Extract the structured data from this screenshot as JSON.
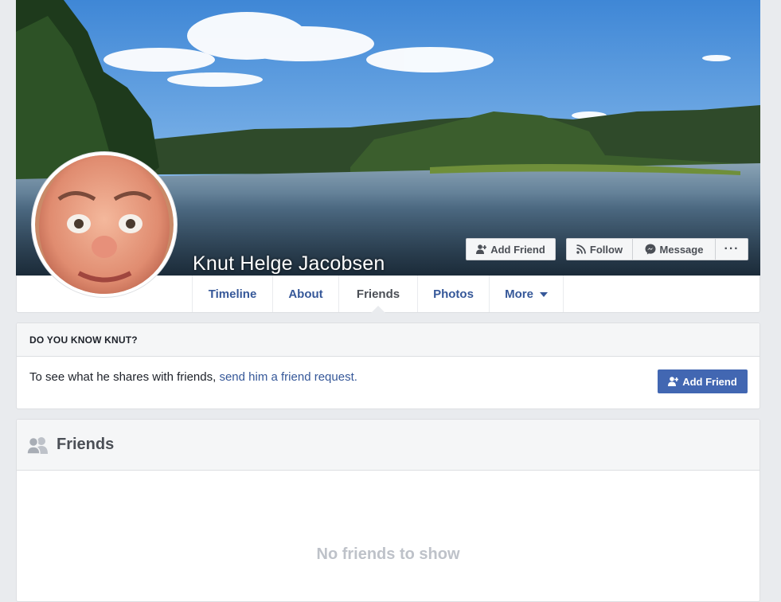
{
  "profile": {
    "name": "Knut Helge Jacobsen"
  },
  "actions": {
    "add_friend": "Add Friend",
    "follow": "Follow",
    "message": "Message",
    "more_dots": "···"
  },
  "tabs": [
    {
      "label": "Timeline"
    },
    {
      "label": "About"
    },
    {
      "label": "Friends"
    },
    {
      "label": "Photos"
    },
    {
      "label": "More"
    }
  ],
  "know_card": {
    "heading": "DO YOU KNOW KNUT?",
    "text": "To see what he shares with friends, ",
    "link": "send him a friend request.",
    "button": "Add Friend"
  },
  "friends_card": {
    "title": "Friends",
    "empty_message": "No friends to show"
  },
  "colors": {
    "link_blue": "#365899",
    "primary_button": "#4267b2",
    "page_bg": "#e9ebee"
  },
  "icons": {
    "add_friend": "add-friend-icon",
    "follow": "rss-follow-icon",
    "message": "messenger-icon",
    "more": "more-dots-icon",
    "dropdown": "caret-down-icon",
    "friends": "friends-people-icon"
  }
}
